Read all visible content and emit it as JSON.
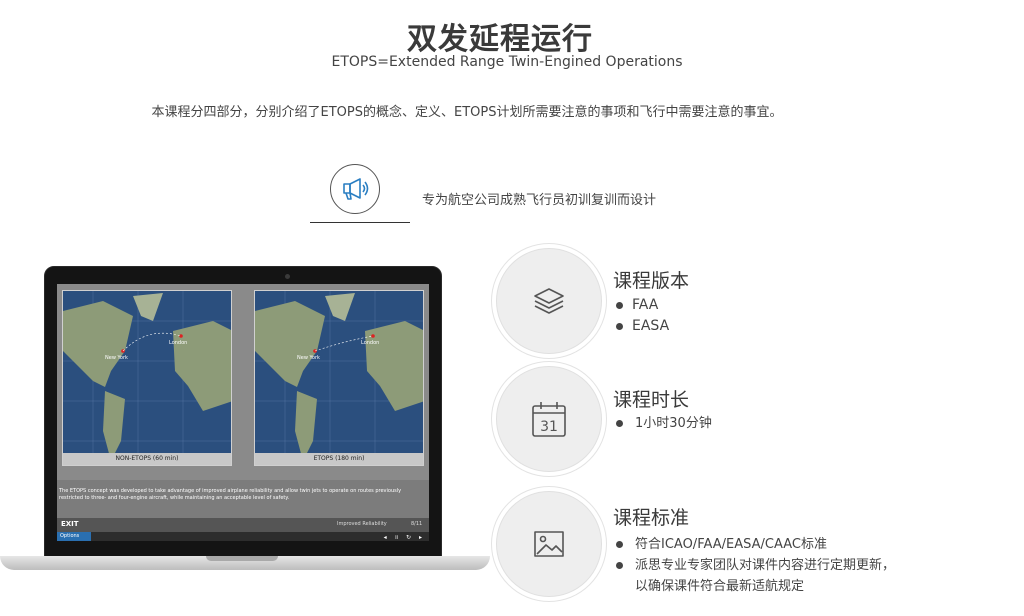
{
  "header": {
    "title": "双发延程运行",
    "subtitle": "ETOPS=Extended Range Twin-Engined Operations",
    "intro": "本课程分四部分，分别介绍了ETOPS的概念、定义、ETOPS计划所需要注意的事项和飞行中需要注意的事宜。"
  },
  "badge": {
    "icon": "megaphone-icon",
    "text": "专为航空公司成熟飞行员初训复训而设计"
  },
  "laptop": {
    "maps": [
      {
        "caption": "NON-ETOPS (60 min)",
        "city_a": "New York",
        "city_b": "London"
      },
      {
        "caption": "ETOPS (180 min)",
        "city_a": "New York",
        "city_b": "London"
      }
    ],
    "body_text": "The ETOPS concept was developed to take advantage of improved airplane reliability and allow twin jets to operate on routes previously restricted to three- and four-engine aircraft, while maintaining an acceptable level of safety.",
    "exit_label": "EXIT",
    "slide_label": "Improved Reliability",
    "page": "8/11",
    "options_label": "Options"
  },
  "features": [
    {
      "icon": "layers-icon",
      "title": "课程版本",
      "items": [
        "FAA",
        "EASA"
      ]
    },
    {
      "icon": "calendar-icon",
      "title": "课程时长",
      "items": [
        "1小时30分钟"
      ],
      "calendar_day": "31"
    },
    {
      "icon": "image-icon",
      "title": "课程标准",
      "items": [
        "符合ICAO/FAA/EASA/CAAC标准",
        "派思专业专家团队对课件内容进行定期更新，",
        "以确保课件符合最新适航规定"
      ]
    }
  ],
  "colors": {
    "accent": "#2a6fb0",
    "ocean": "#2b4f7e"
  }
}
